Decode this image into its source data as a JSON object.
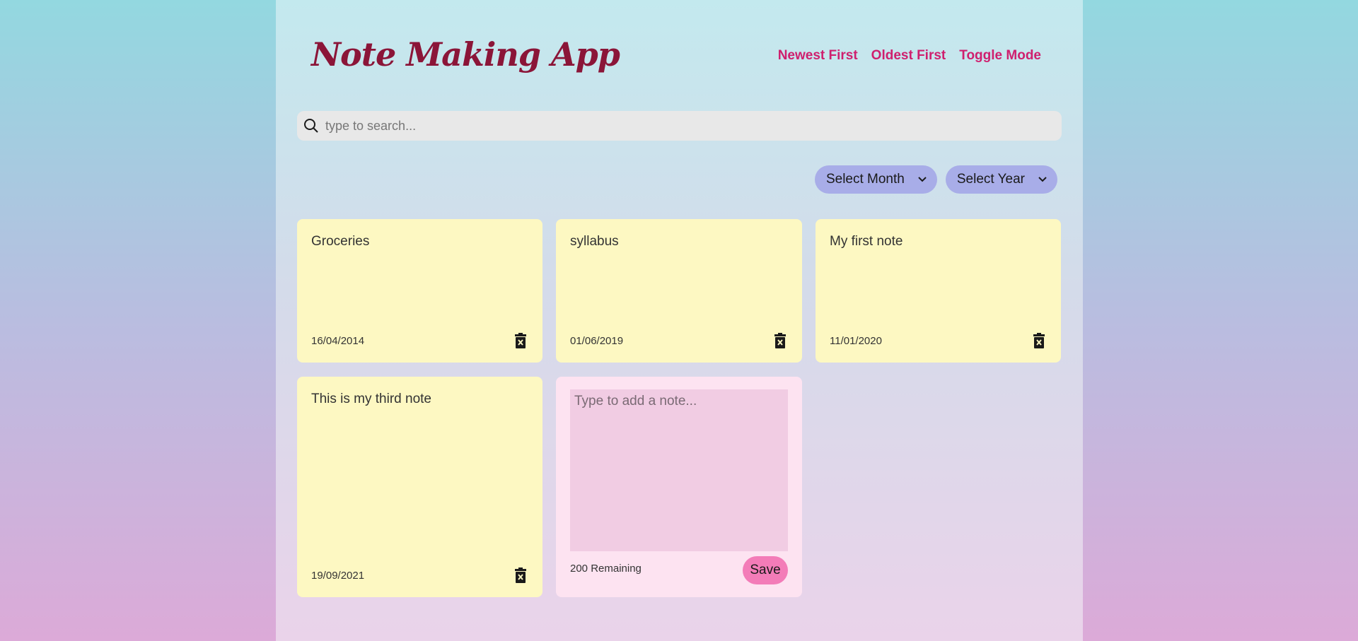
{
  "header": {
    "title": "Note Making App",
    "nav": [
      "Newest First",
      "Oldest First",
      "Toggle Mode"
    ]
  },
  "search": {
    "placeholder": "type to search...",
    "value": ""
  },
  "filters": {
    "month_label": "Select Month",
    "year_label": "Select Year"
  },
  "notes": [
    {
      "text": "Groceries",
      "date": "16/04/2014"
    },
    {
      "text": "syllabus",
      "date": "01/06/2019"
    },
    {
      "text": "My first note",
      "date": "11/01/2020"
    },
    {
      "text": "This is my third note",
      "date": "19/09/2021"
    }
  ],
  "new_note": {
    "placeholder": "Type to add a note...",
    "remaining": "200 Remaining",
    "save_label": "Save"
  },
  "colors": {
    "title": "#8b1538",
    "nav": "#cf1f6e",
    "note_bg": "#fdf8c2",
    "new_note_bg": "#fde3f1",
    "select_bg": "#a8ade8",
    "save_bg": "#f37cb8"
  }
}
